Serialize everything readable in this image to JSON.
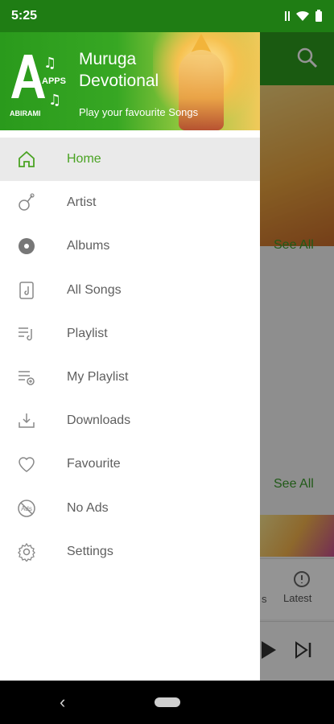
{
  "status_bar": {
    "time": "5:25"
  },
  "background_app": {
    "see_all_top": "See All",
    "see_all_bottom": "See All",
    "nav_latest": "Latest",
    "nav_partial": "s"
  },
  "drawer": {
    "header": {
      "title": "Muruga Devotional",
      "subtitle": "Play your favourite Songs",
      "logo_text_top": "APPS",
      "logo_text_bottom": "ABIRAMI"
    },
    "items": [
      {
        "label": "Home",
        "icon": "home-icon",
        "active": true
      },
      {
        "label": "Artist",
        "icon": "artist-icon",
        "active": false
      },
      {
        "label": "Albums",
        "icon": "album-icon",
        "active": false
      },
      {
        "label": "All Songs",
        "icon": "song-icon",
        "active": false
      },
      {
        "label": "Playlist",
        "icon": "playlist-icon",
        "active": false
      },
      {
        "label": "My Playlist",
        "icon": "my-playlist-icon",
        "active": false
      },
      {
        "label": "Downloads",
        "icon": "download-icon",
        "active": false
      },
      {
        "label": "Favourite",
        "icon": "heart-icon",
        "active": false
      },
      {
        "label": "No Ads",
        "icon": "no-ads-icon",
        "active": false
      },
      {
        "label": "Settings",
        "icon": "gear-icon",
        "active": false
      }
    ]
  },
  "colors": {
    "accent": "#4aa323",
    "statusbar": "#1f7d14",
    "drawer_active_bg": "#eaeaea",
    "text_gray": "#5f5f5f"
  }
}
